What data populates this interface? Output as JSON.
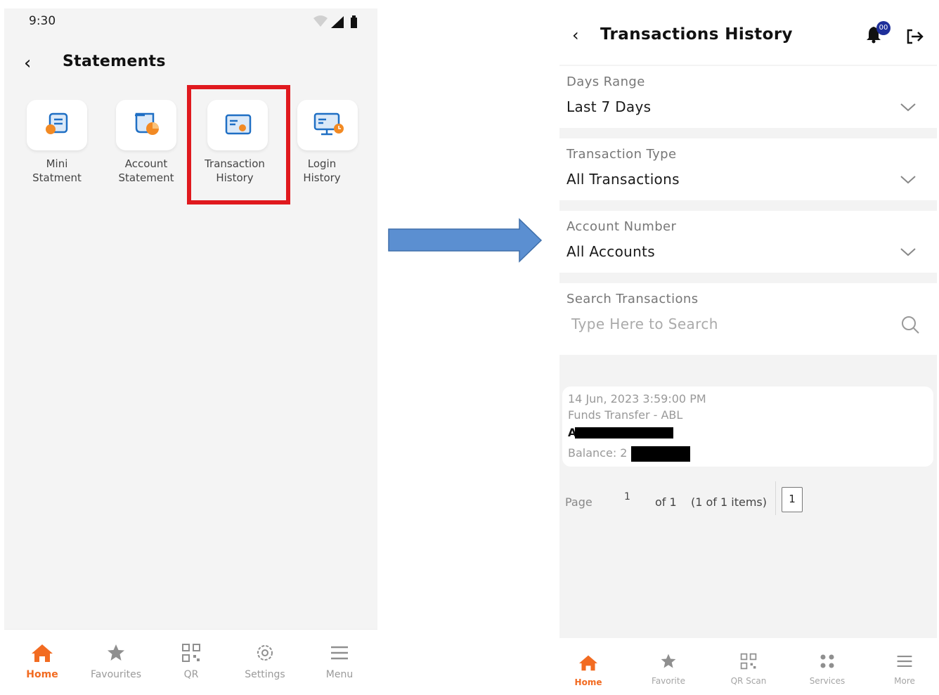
{
  "left_screen": {
    "status_time": "9:30",
    "title": "Statements",
    "tiles": [
      {
        "label_line1": "Mini",
        "label_line2": "Statment",
        "icon": "mini-statement-icon"
      },
      {
        "label_line1": "Account",
        "label_line2": "Statement",
        "icon": "account-statement-icon"
      },
      {
        "label_line1": "Transaction",
        "label_line2": "History",
        "icon": "transaction-history-icon"
      },
      {
        "label_line1": "Login",
        "label_line2": "History",
        "icon": "login-history-icon"
      }
    ],
    "highlight_color": "#e0191e",
    "bottom_nav": [
      {
        "label": "Home",
        "icon": "home-icon",
        "active": true
      },
      {
        "label": "Favourites",
        "icon": "star-icon",
        "active": false
      },
      {
        "label": "QR",
        "icon": "qr-icon",
        "active": false
      },
      {
        "label": "Settings",
        "icon": "gear-icon",
        "active": false
      },
      {
        "label": "Menu",
        "icon": "menu-icon",
        "active": false
      }
    ]
  },
  "right_screen": {
    "title": "Transactions History",
    "notification_badge": "00",
    "fields": {
      "days_range": {
        "label": "Days Range",
        "value": "Last 7 Days"
      },
      "transaction_type": {
        "label": "Transaction Type",
        "value": "All Transactions"
      },
      "account_number": {
        "label": "Account Number",
        "value": "All Accounts"
      },
      "search": {
        "label": "Search Transactions",
        "placeholder": "Type Here to Search"
      }
    },
    "transaction": {
      "date": "14 Jun, 2023 3:59:00 PM",
      "description": "Funds Transfer - ABL",
      "name_visible": "A",
      "balance_visible": "Balance: 2"
    },
    "pager": {
      "page_label": "Page",
      "current_page": "1",
      "of_label": "of 1",
      "items_label": "(1 of 1 items)",
      "page_button": "1"
    },
    "bottom_nav": [
      {
        "label": "Home",
        "icon": "home-icon",
        "active": true
      },
      {
        "label": "Favorite",
        "icon": "star-icon",
        "active": false
      },
      {
        "label": "QR Scan",
        "icon": "qr-icon",
        "active": false
      },
      {
        "label": "Services",
        "icon": "services-icon",
        "active": false
      },
      {
        "label": "More",
        "icon": "menu-icon",
        "active": false
      }
    ]
  },
  "colors": {
    "accent": "#f26b21",
    "arrow": "#5b8fd1"
  }
}
